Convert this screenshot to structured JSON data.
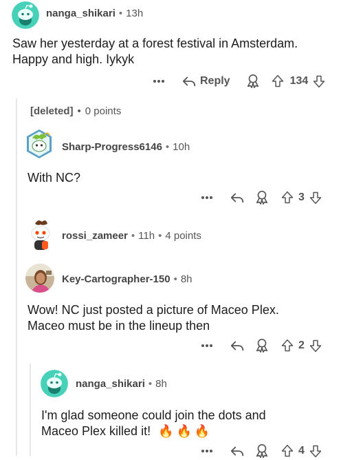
{
  "comments": [
    {
      "username": "nanga_shikari",
      "time": "13h",
      "text_lines": [
        "Saw her yesterday at a forest festival in Amsterdam.",
        "Happy and high. Iykyk"
      ],
      "reply_label": "Reply",
      "votes": "134"
    },
    {
      "username": "[deleted]",
      "points": "0 points"
    },
    {
      "username": "Sharp-Progress6146",
      "time": "10h",
      "text_lines": [
        "With NC?"
      ],
      "votes": "3"
    },
    {
      "username": "rossi_zameer",
      "time": "11h",
      "points": "4 points"
    },
    {
      "username": "Key-Cartographer-150",
      "time": "8h",
      "text_lines": [
        "Wow! NC just posted a picture of Maceo Plex.",
        "Maceo must be in the lineup then"
      ],
      "votes": "2"
    },
    {
      "username": "nanga_shikari",
      "time": "8h",
      "text_lines": [
        "I'm glad someone could join the dots and",
        "Maceo Plex killed it!"
      ],
      "emoji": "🔥🔥🔥",
      "votes": "4"
    }
  ],
  "icons": {
    "more": "more-dots-icon",
    "reply": "reply-arrow-icon",
    "award": "award-icon",
    "upvote": "upvote-arrow-icon",
    "downvote": "downvote-arrow-icon"
  },
  "colors": {
    "snoo_teal": "#46d1b8",
    "meta_gray": "#555555",
    "thread_line": "#e6e6e6",
    "fire": "#ff5a1f"
  }
}
